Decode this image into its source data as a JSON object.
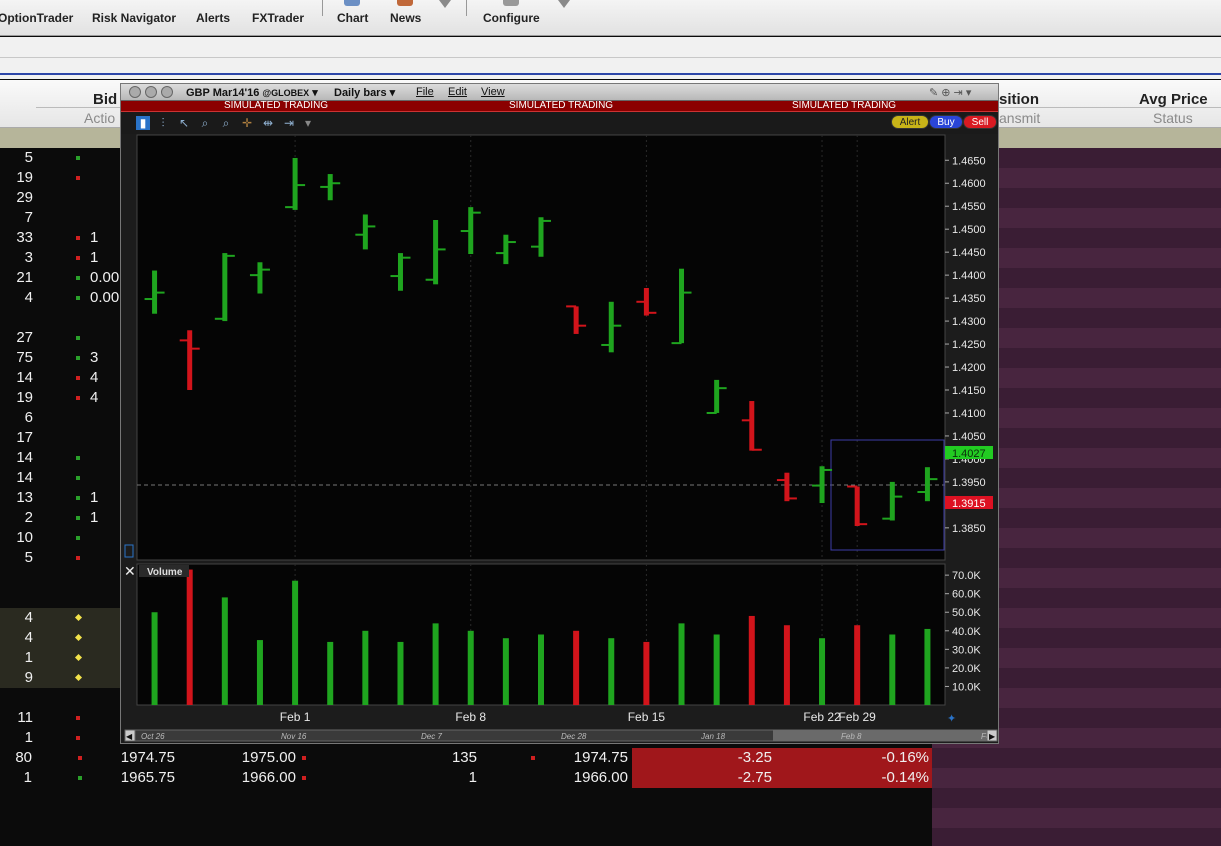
{
  "toolbar": {
    "items": [
      "OptionTrader",
      "Risk Navigator",
      "Alerts",
      "FXTrader",
      "Chart",
      "News",
      "Configure"
    ]
  },
  "columns": {
    "bid": "Bid",
    "action": "Actio",
    "position": "sition",
    "transmit": "ansmit",
    "avg_price": "Avg Price",
    "status": "Status"
  },
  "rows": [
    {
      "n": "5",
      "mark": "green",
      "bid": ""
    },
    {
      "n": "19",
      "mark": "red",
      "bid": ""
    },
    {
      "n": "29",
      "mark": "",
      "bid": ""
    },
    {
      "n": "7",
      "mark": "",
      "bid": ""
    },
    {
      "n": "33",
      "mark": "red",
      "bid": "1"
    },
    {
      "n": "3",
      "mark": "red",
      "bid": "1"
    },
    {
      "n": "21",
      "mark": "green",
      "bid": "0.00"
    },
    {
      "n": "4",
      "mark": "green",
      "bid": "0.00"
    },
    {
      "n": "",
      "mark": "",
      "bid": ""
    },
    {
      "n": "27",
      "mark": "green",
      "bid": ""
    },
    {
      "n": "75",
      "mark": "green",
      "bid": "3"
    },
    {
      "n": "14",
      "mark": "red",
      "bid": "4"
    },
    {
      "n": "19",
      "mark": "red",
      "bid": "4"
    },
    {
      "n": "6",
      "mark": "",
      "bid": ""
    },
    {
      "n": "17",
      "mark": "",
      "bid": ""
    },
    {
      "n": "14",
      "mark": "green",
      "bid": ""
    },
    {
      "n": "14",
      "mark": "green",
      "bid": ""
    },
    {
      "n": "13",
      "mark": "green",
      "bid": "1"
    },
    {
      "n": "2",
      "mark": "green",
      "bid": "1"
    },
    {
      "n": "10",
      "mark": "green",
      "bid": ""
    },
    {
      "n": "5",
      "mark": "red",
      "bid": ""
    },
    {
      "n": "",
      "mark": "",
      "bid": ""
    },
    {
      "n": "",
      "mark": "",
      "bid": ""
    },
    {
      "n": "4",
      "mark": "yellow",
      "bid": ""
    },
    {
      "n": "4",
      "mark": "yellow",
      "bid": ""
    },
    {
      "n": "1",
      "mark": "yellow",
      "bid": ""
    },
    {
      "n": "9",
      "mark": "yellow",
      "bid": ""
    },
    {
      "n": "",
      "mark": "",
      "bid": ""
    },
    {
      "n": "11",
      "mark": "red",
      "bid": ""
    },
    {
      "n": "1",
      "mark": "red",
      "bid": ""
    }
  ],
  "bottom_rows": [
    {
      "n": "80",
      "bid": "1974.75",
      "ask": "1975.00",
      "size": "135",
      "last": "1974.75",
      "change": "-3.25",
      "pct": "-0.16%"
    },
    {
      "n": "1",
      "bid": "1965.75",
      "ask": "1966.00",
      "size": "1",
      "last": "1966.00",
      "change": "-2.75",
      "pct": "-0.14%"
    }
  ],
  "chart_window": {
    "symbol": "GBP Mar14'16",
    "exchange": "@GLOBEX",
    "bar_type": "Daily bars",
    "menus": [
      "File",
      "Edit",
      "View"
    ],
    "simulated_label": "SIMULATED TRADING",
    "buttons": {
      "alert": "Alert",
      "buy": "Buy",
      "sell": "Sell"
    },
    "volume_label": "Volume",
    "price_tag_upper": "1.4027",
    "price_tag_lower": "1.3915",
    "price_tag_upper_color": "#22cc22",
    "price_tag_lower_color": "#dd1122",
    "nav_labels": [
      "Oct 26",
      "Nov 16",
      "Dec 7",
      "Dec 28",
      "Jan 18",
      "Feb 8",
      "Feb"
    ]
  },
  "chart_data": {
    "type": "ohlc",
    "up_color": "#1fa51f",
    "down_color": "#d2141b",
    "x_ticks": [
      "Feb 1",
      "Feb 8",
      "Feb 15",
      "Feb 22",
      "Feb 29"
    ],
    "y_ticks": [
      "1.4650",
      "1.4600",
      "1.4550",
      "1.4500",
      "1.4450",
      "1.4400",
      "1.4350",
      "1.4300",
      "1.4250",
      "1.4200",
      "1.4150",
      "1.4100",
      "1.4050",
      "1.4000",
      "1.3950",
      "1.3900",
      "1.3850"
    ],
    "ylim": [
      1.378,
      1.4705
    ],
    "volume_ticks": [
      "70.0K",
      "60.0K",
      "50.0K",
      "40.0K",
      "30.0K",
      "20.0K",
      "10.0K"
    ],
    "volume_lim": [
      0,
      76000
    ],
    "bars": [
      {
        "date": "Jan 26",
        "open": 1.4348,
        "high": 1.441,
        "low": 1.4316,
        "close": 1.4362,
        "volume": 50000
      },
      {
        "date": "Jan 27",
        "open": 1.4258,
        "high": 1.428,
        "low": 1.415,
        "close": 1.424,
        "volume": 73000
      },
      {
        "date": "Jan 28",
        "open": 1.4305,
        "high": 1.4448,
        "low": 1.43,
        "close": 1.4442,
        "volume": 58000
      },
      {
        "date": "Jan 29",
        "open": 1.44,
        "high": 1.4428,
        "low": 1.436,
        "close": 1.4412,
        "volume": 35000
      },
      {
        "date": "Feb 1",
        "open": 1.4548,
        "high": 1.4655,
        "low": 1.4542,
        "close": 1.4596,
        "volume": 67000
      },
      {
        "date": "Feb 2",
        "open": 1.4592,
        "high": 1.462,
        "low": 1.4563,
        "close": 1.46,
        "volume": 34000
      },
      {
        "date": "Feb 3",
        "open": 1.4488,
        "high": 1.4532,
        "low": 1.4456,
        "close": 1.4506,
        "volume": 40000
      },
      {
        "date": "Feb 4",
        "open": 1.4398,
        "high": 1.4448,
        "low": 1.4366,
        "close": 1.4438,
        "volume": 34000
      },
      {
        "date": "Feb 5",
        "open": 1.439,
        "high": 1.452,
        "low": 1.438,
        "close": 1.4456,
        "volume": 44000
      },
      {
        "date": "Feb 8",
        "open": 1.4496,
        "high": 1.4548,
        "low": 1.4446,
        "close": 1.4536,
        "volume": 40000
      },
      {
        "date": "Feb 9",
        "open": 1.4448,
        "high": 1.4488,
        "low": 1.4424,
        "close": 1.4472,
        "volume": 36000
      },
      {
        "date": "Feb 10",
        "open": 1.4462,
        "high": 1.4526,
        "low": 1.444,
        "close": 1.4518,
        "volume": 38000
      },
      {
        "date": "Feb 11",
        "open": 1.4332,
        "high": 1.4332,
        "low": 1.4272,
        "close": 1.429,
        "volume": 40000
      },
      {
        "date": "Feb 12",
        "open": 1.4248,
        "high": 1.4342,
        "low": 1.4232,
        "close": 1.429,
        "volume": 36000
      },
      {
        "date": "Feb 15",
        "open": 1.4342,
        "high": 1.4372,
        "low": 1.4312,
        "close": 1.4318,
        "volume": 34000
      },
      {
        "date": "Feb 16",
        "open": 1.4252,
        "high": 1.4414,
        "low": 1.4252,
        "close": 1.4362,
        "volume": 44000
      },
      {
        "date": "Feb 17",
        "open": 1.41,
        "high": 1.4172,
        "low": 1.41,
        "close": 1.4154,
        "volume": 38000
      },
      {
        "date": "Feb 18",
        "open": 1.4084,
        "high": 1.4126,
        "low": 1.4018,
        "close": 1.402,
        "volume": 48000
      },
      {
        "date": "Feb 19",
        "open": 1.3954,
        "high": 1.397,
        "low": 1.3908,
        "close": 1.3914,
        "volume": 43000
      },
      {
        "date": "Feb 22",
        "open": 1.3942,
        "high": 1.3984,
        "low": 1.3904,
        "close": 1.3976,
        "volume": 36000
      },
      {
        "date": "Feb 23",
        "open": 1.394,
        "high": 1.394,
        "low": 1.3854,
        "close": 1.3858,
        "volume": 43000
      },
      {
        "date": "Feb 24",
        "open": 1.387,
        "high": 1.395,
        "low": 1.3866,
        "close": 1.3918,
        "volume": 38000
      },
      {
        "date": "Feb 25",
        "open": 1.3928,
        "high": 1.3982,
        "low": 1.3908,
        "close": 1.3956,
        "volume": 41000
      }
    ]
  }
}
